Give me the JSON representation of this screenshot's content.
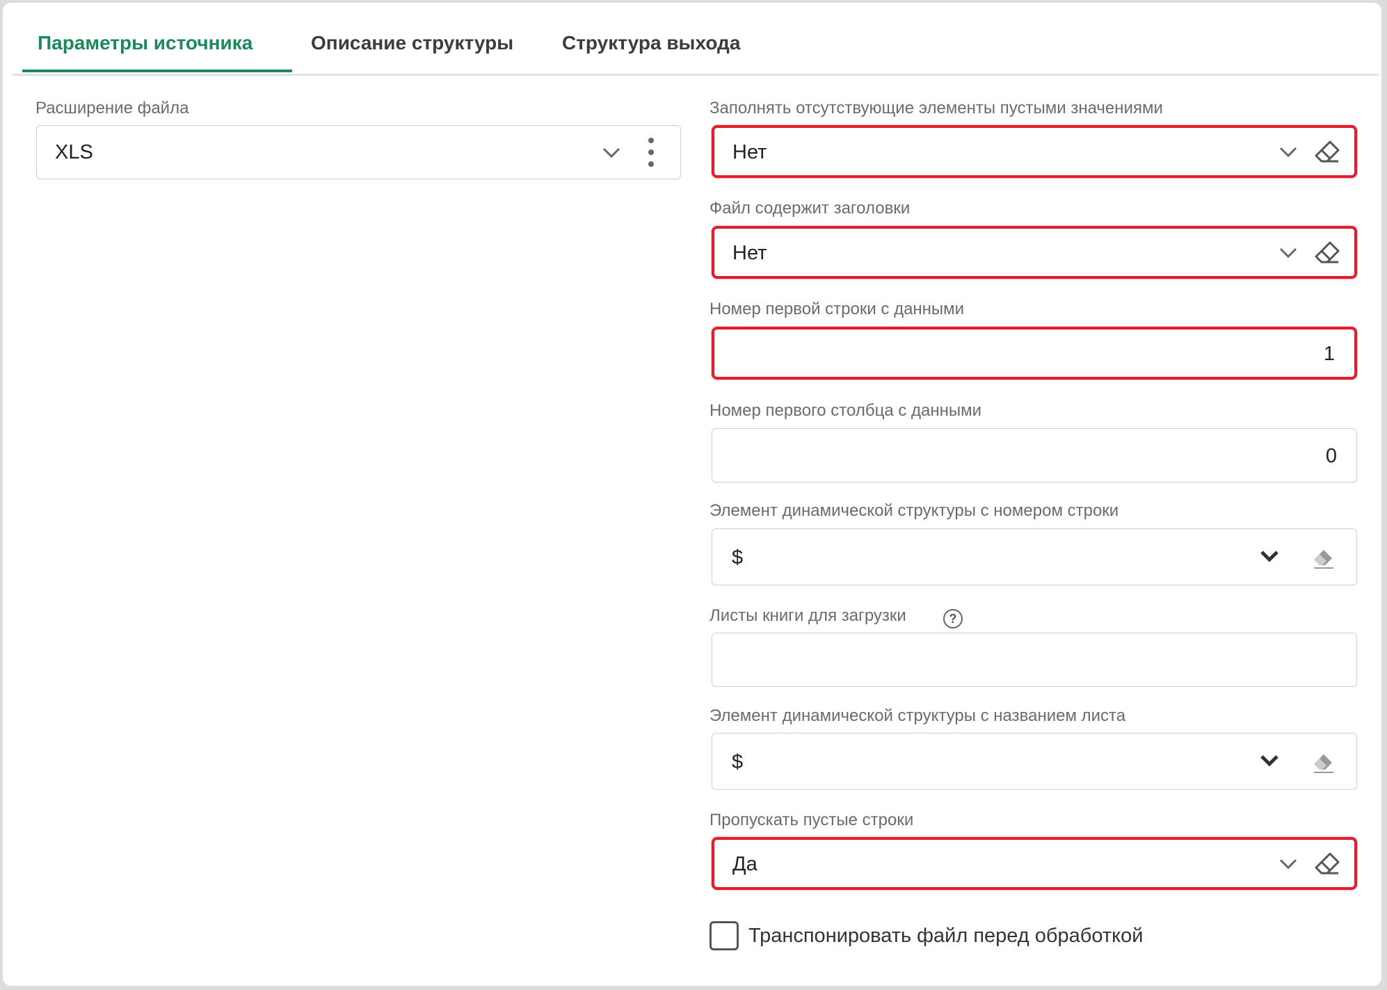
{
  "tabs": [
    {
      "label": "Параметры источника",
      "active": true
    },
    {
      "label": "Описание структуры",
      "active": false
    },
    {
      "label": "Структура выхода",
      "active": false
    }
  ],
  "left": {
    "file_extension": {
      "label": "Расширение файла",
      "value": "XLS"
    }
  },
  "right": {
    "fill_missing": {
      "label": "Заполнять отсутствующие элементы пустыми значениями",
      "value": "Нет"
    },
    "has_headers": {
      "label": "Файл содержит заголовки",
      "value": "Нет"
    },
    "first_data_row": {
      "label": "Номер первой строки с данными",
      "value": "1"
    },
    "first_data_col": {
      "label": "Номер первого столбца с данными",
      "value": "0"
    },
    "row_number_element": {
      "label": "Элемент динамической структуры с номером строки",
      "value": "$"
    },
    "sheets_to_load": {
      "label": "Листы книги для загрузки",
      "value": "",
      "help": "?"
    },
    "sheet_name_element": {
      "label": "Элемент динамической структуры с названием листа",
      "value": "$"
    },
    "skip_empty_rows": {
      "label": "Пропускать пустые строки",
      "value": "Да"
    },
    "transpose": {
      "label": "Транспонировать файл перед обработкой",
      "checked": false
    }
  },
  "colors": {
    "accent": "#1b8a5a",
    "highlight": "#e31d2b",
    "border": "#cfcfcf"
  },
  "icons": {
    "dropdown": "chevron-down-icon",
    "clear": "eraser-icon",
    "more": "more-vertical-icon",
    "help": "help-circle-icon"
  }
}
